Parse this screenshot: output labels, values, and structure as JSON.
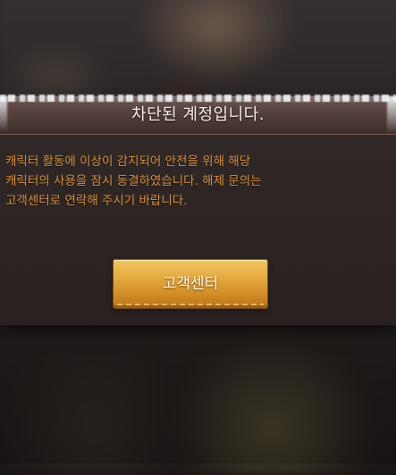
{
  "dialog": {
    "title": "차단된 계정입니다.",
    "message": "캐릭터 활동에 이상이 감지되어 안전을 위해 해당\n캐릭터의 사용을 잠시 동결하였습니다. 해제 문의는\n고객센터로 연락해 주시기 바랍니다.",
    "button_label": "고객센터"
  },
  "colors": {
    "message_text": "#d6903a",
    "button": "#e4a73c",
    "panel": "#2b2321",
    "title_text": "#f4ede6"
  }
}
